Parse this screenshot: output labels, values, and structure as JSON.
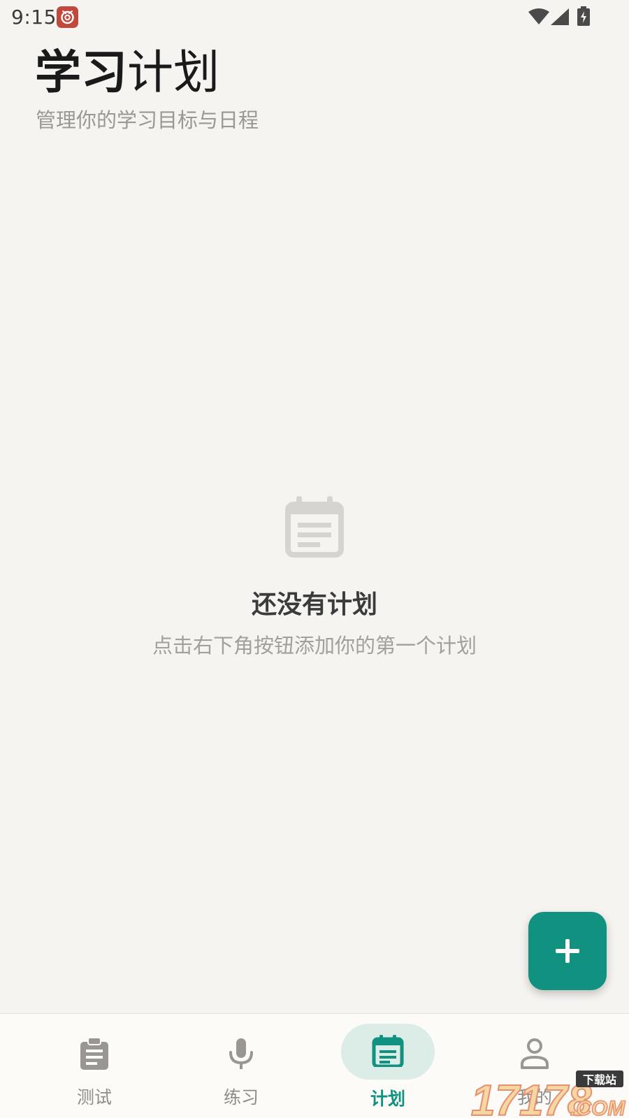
{
  "status_bar": {
    "time": "9:15",
    "icons": [
      "notification-app-icon",
      "wifi-icon",
      "signal-icon",
      "battery-charging-icon"
    ]
  },
  "header": {
    "title_strong": "学习",
    "title_light": "计划",
    "subtitle": "管理你的学习目标与日程"
  },
  "empty_state": {
    "icon": "calendar-note-icon",
    "title": "还没有计划",
    "description": "点击右下角按钮添加你的第一个计划"
  },
  "fab": {
    "icon": "plus-icon"
  },
  "bottom_nav": {
    "active_index": 2,
    "items": [
      {
        "label": "测试",
        "icon": "clipboard-icon"
      },
      {
        "label": "练习",
        "icon": "microphone-icon"
      },
      {
        "label": "计划",
        "icon": "calendar-icon"
      },
      {
        "label": "我的",
        "icon": "person-icon"
      }
    ]
  },
  "watermark": {
    "text": "17178",
    "badge": "下载站",
    "suffix": ".COM"
  },
  "colors": {
    "accent": "#11917f",
    "accent_light": "#dcece7",
    "background": "#f5f4f1",
    "nav_background": "#fcfbf8",
    "muted_text": "#a3a09c"
  }
}
